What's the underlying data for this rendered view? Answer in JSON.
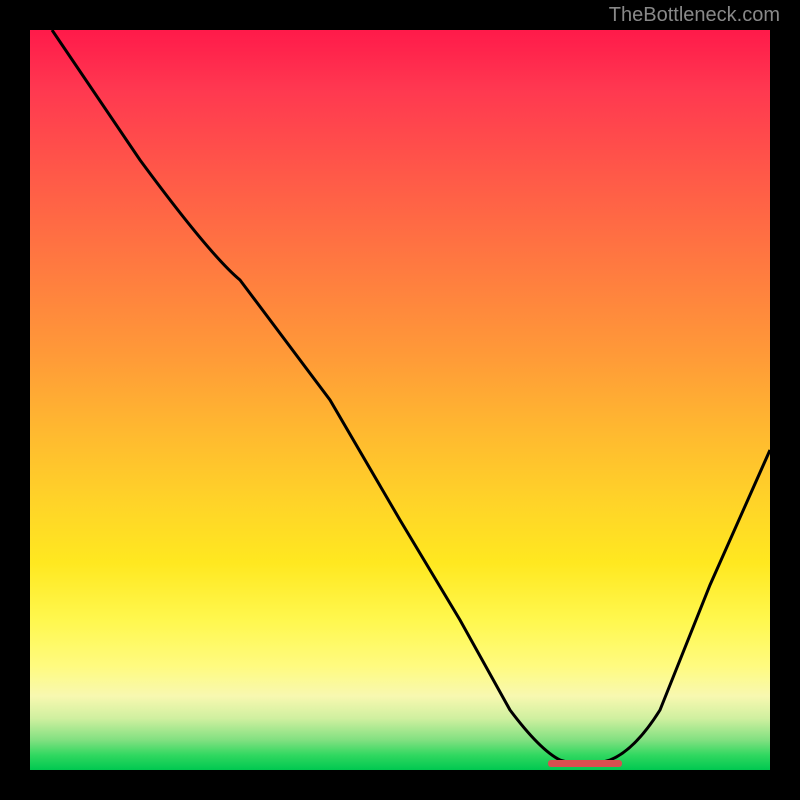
{
  "watermark": "TheBottleneck.com",
  "chart_data": {
    "type": "line",
    "title": "",
    "xlabel": "",
    "ylabel": "",
    "x_range": [
      0,
      100
    ],
    "y_range": [
      0,
      100
    ],
    "curve": {
      "description": "Bottleneck curve descending from top-left to a minimum then rising to right edge",
      "points": [
        {
          "x": 3,
          "y": 100
        },
        {
          "x": 15,
          "y": 82
        },
        {
          "x": 28,
          "y": 68
        },
        {
          "x": 40,
          "y": 50
        },
        {
          "x": 50,
          "y": 34
        },
        {
          "x": 58,
          "y": 20
        },
        {
          "x": 65,
          "y": 8
        },
        {
          "x": 70,
          "y": 2
        },
        {
          "x": 75,
          "y": 0.5
        },
        {
          "x": 80,
          "y": 2
        },
        {
          "x": 85,
          "y": 10
        },
        {
          "x": 92,
          "y": 25
        },
        {
          "x": 100,
          "y": 43
        }
      ]
    },
    "minimum_marker": {
      "x_start": 70,
      "x_end": 80,
      "y": 0.5,
      "color": "#d85050"
    },
    "gradient_colors": {
      "top": "#ff1a4a",
      "middle": "#ffd428",
      "bottom": "#00c850"
    }
  }
}
